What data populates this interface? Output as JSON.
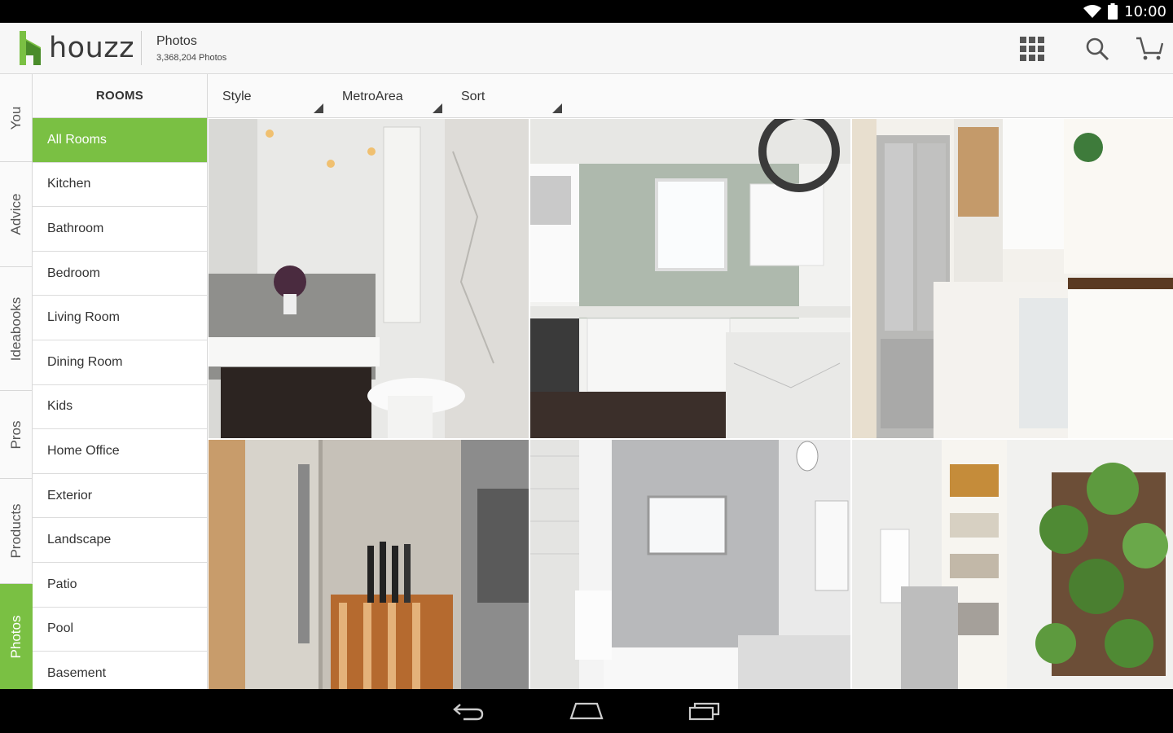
{
  "status_bar": {
    "time": "10:00",
    "wifi_icon": "wifi-icon",
    "battery_icon": "battery-icon"
  },
  "header": {
    "logo_text": "houzz",
    "title": "Photos",
    "subtitle": "3,368,204 Photos",
    "icons": [
      "grid-view-icon",
      "search-icon",
      "cart-icon"
    ]
  },
  "side_tabs": [
    {
      "label": "You"
    },
    {
      "label": "Advice"
    },
    {
      "label": "Ideabooks"
    },
    {
      "label": "Pros"
    },
    {
      "label": "Products"
    },
    {
      "label": "Photos",
      "active": true
    }
  ],
  "rooms": {
    "heading": "ROOMS",
    "items": [
      {
        "label": "All Rooms",
        "active": true
      },
      {
        "label": "Kitchen"
      },
      {
        "label": "Bathroom"
      },
      {
        "label": "Bedroom"
      },
      {
        "label": "Living Room"
      },
      {
        "label": "Dining Room"
      },
      {
        "label": "Kids"
      },
      {
        "label": "Home Office"
      },
      {
        "label": "Exterior"
      },
      {
        "label": "Landscape"
      },
      {
        "label": "Patio"
      },
      {
        "label": "Pool"
      },
      {
        "label": "Basement"
      }
    ]
  },
  "filters": [
    {
      "label": "Style"
    },
    {
      "label": "MetroArea"
    },
    {
      "label": "Sort"
    }
  ],
  "photos": [
    {
      "subject": "bathroom-vanity"
    },
    {
      "subject": "white-kitchen"
    },
    {
      "subject": "kitchen-fridge-organizer"
    },
    {
      "subject": "knife-block-cabinet"
    },
    {
      "subject": "marble-bathroom"
    },
    {
      "subject": "pantry-herb-wall"
    }
  ],
  "nav_bar": {
    "icons": [
      "back-icon",
      "home-icon",
      "recents-icon"
    ]
  },
  "colors": {
    "accent": "#7ac043",
    "text": "#333333",
    "divider": "#d8d8d8"
  }
}
